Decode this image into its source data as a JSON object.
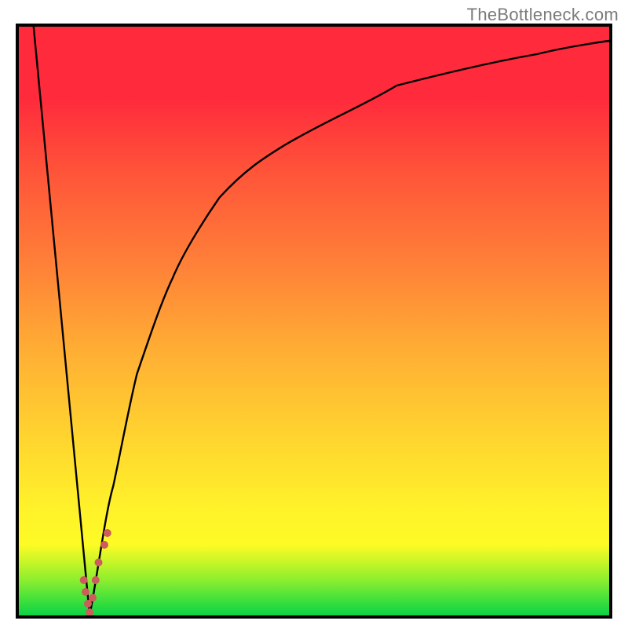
{
  "watermark_text": "TheBottleneck.com",
  "colors": {
    "frame": "#000000",
    "watermark": "#7b7b7b"
  },
  "chart_data": {
    "type": "line",
    "title": "",
    "xlabel": "",
    "ylabel": "",
    "xlim": [
      0,
      100
    ],
    "ylim": [
      0,
      100
    ],
    "grid": false,
    "legend": false,
    "gradient_bands": [
      {
        "y0": 0,
        "y1": 3,
        "color": "#0bd346"
      },
      {
        "y0": 3,
        "y1": 6,
        "color": "#48e23a"
      },
      {
        "y0": 6,
        "y1": 9,
        "color": "#8cee2f"
      },
      {
        "y0": 9,
        "y1": 12,
        "color": "#c6f528"
      },
      {
        "y0": 12,
        "y1": 18,
        "color": "#fdfb25"
      },
      {
        "y0": 18,
        "y1": 30,
        "color": "#fff22a"
      },
      {
        "y0": 30,
        "y1": 45,
        "color": "#ffd52f"
      },
      {
        "y0": 45,
        "y1": 60,
        "color": "#ffae34"
      },
      {
        "y0": 60,
        "y1": 75,
        "color": "#ff7f38"
      },
      {
        "y0": 75,
        "y1": 88,
        "color": "#ff5539"
      },
      {
        "y0": 88,
        "y1": 100,
        "color": "#ff2a3c"
      }
    ],
    "series": [
      {
        "name": "left-branch",
        "color": "#000000",
        "points": [
          {
            "x": 2.5,
            "y": 100
          },
          {
            "x": 12.0,
            "y": 0
          }
        ]
      },
      {
        "name": "right-branch",
        "color": "#000000",
        "points": [
          {
            "x": 12.0,
            "y": 0
          },
          {
            "x": 14.0,
            "y": 10
          },
          {
            "x": 16.0,
            "y": 22
          },
          {
            "x": 18.0,
            "y": 32
          },
          {
            "x": 20.0,
            "y": 41
          },
          {
            "x": 24.0,
            "y": 53
          },
          {
            "x": 28.0,
            "y": 62
          },
          {
            "x": 34.0,
            "y": 71
          },
          {
            "x": 42.0,
            "y": 78
          },
          {
            "x": 52.0,
            "y": 83
          },
          {
            "x": 64.0,
            "y": 86
          },
          {
            "x": 80.0,
            "y": 88
          },
          {
            "x": 100.0,
            "y": 90
          }
        ]
      },
      {
        "name": "dots",
        "color": "#cd5c5c",
        "radius": 5,
        "points": [
          {
            "x": 11.0,
            "y": 6
          },
          {
            "x": 11.3,
            "y": 4
          },
          {
            "x": 11.7,
            "y": 2
          },
          {
            "x": 12.0,
            "y": 0
          },
          {
            "x": 12.5,
            "y": 3
          },
          {
            "x": 13.0,
            "y": 6
          },
          {
            "x": 13.5,
            "y": 9
          },
          {
            "x": 14.5,
            "y": 12
          },
          {
            "x": 15.0,
            "y": 14
          }
        ]
      }
    ]
  }
}
